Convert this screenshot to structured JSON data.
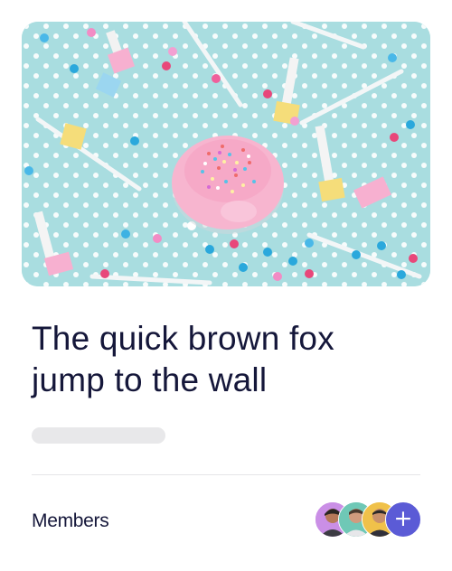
{
  "card": {
    "image": {
      "icon": "party-photo",
      "colors": {
        "background": "#a9dde0",
        "donut": "#f7b5cf"
      }
    },
    "title_line1": "The quick brown fox",
    "title_line2": "jump to the wall"
  },
  "members": {
    "label": "Members",
    "avatars": [
      {
        "icon": "person-avatar",
        "bg": "#ca8fe6"
      },
      {
        "icon": "person-avatar",
        "bg": "#6fc8b6"
      },
      {
        "icon": "person-avatar",
        "bg": "#f0c14a"
      }
    ],
    "add_icon": "+",
    "accent": "#5b5bd6"
  }
}
